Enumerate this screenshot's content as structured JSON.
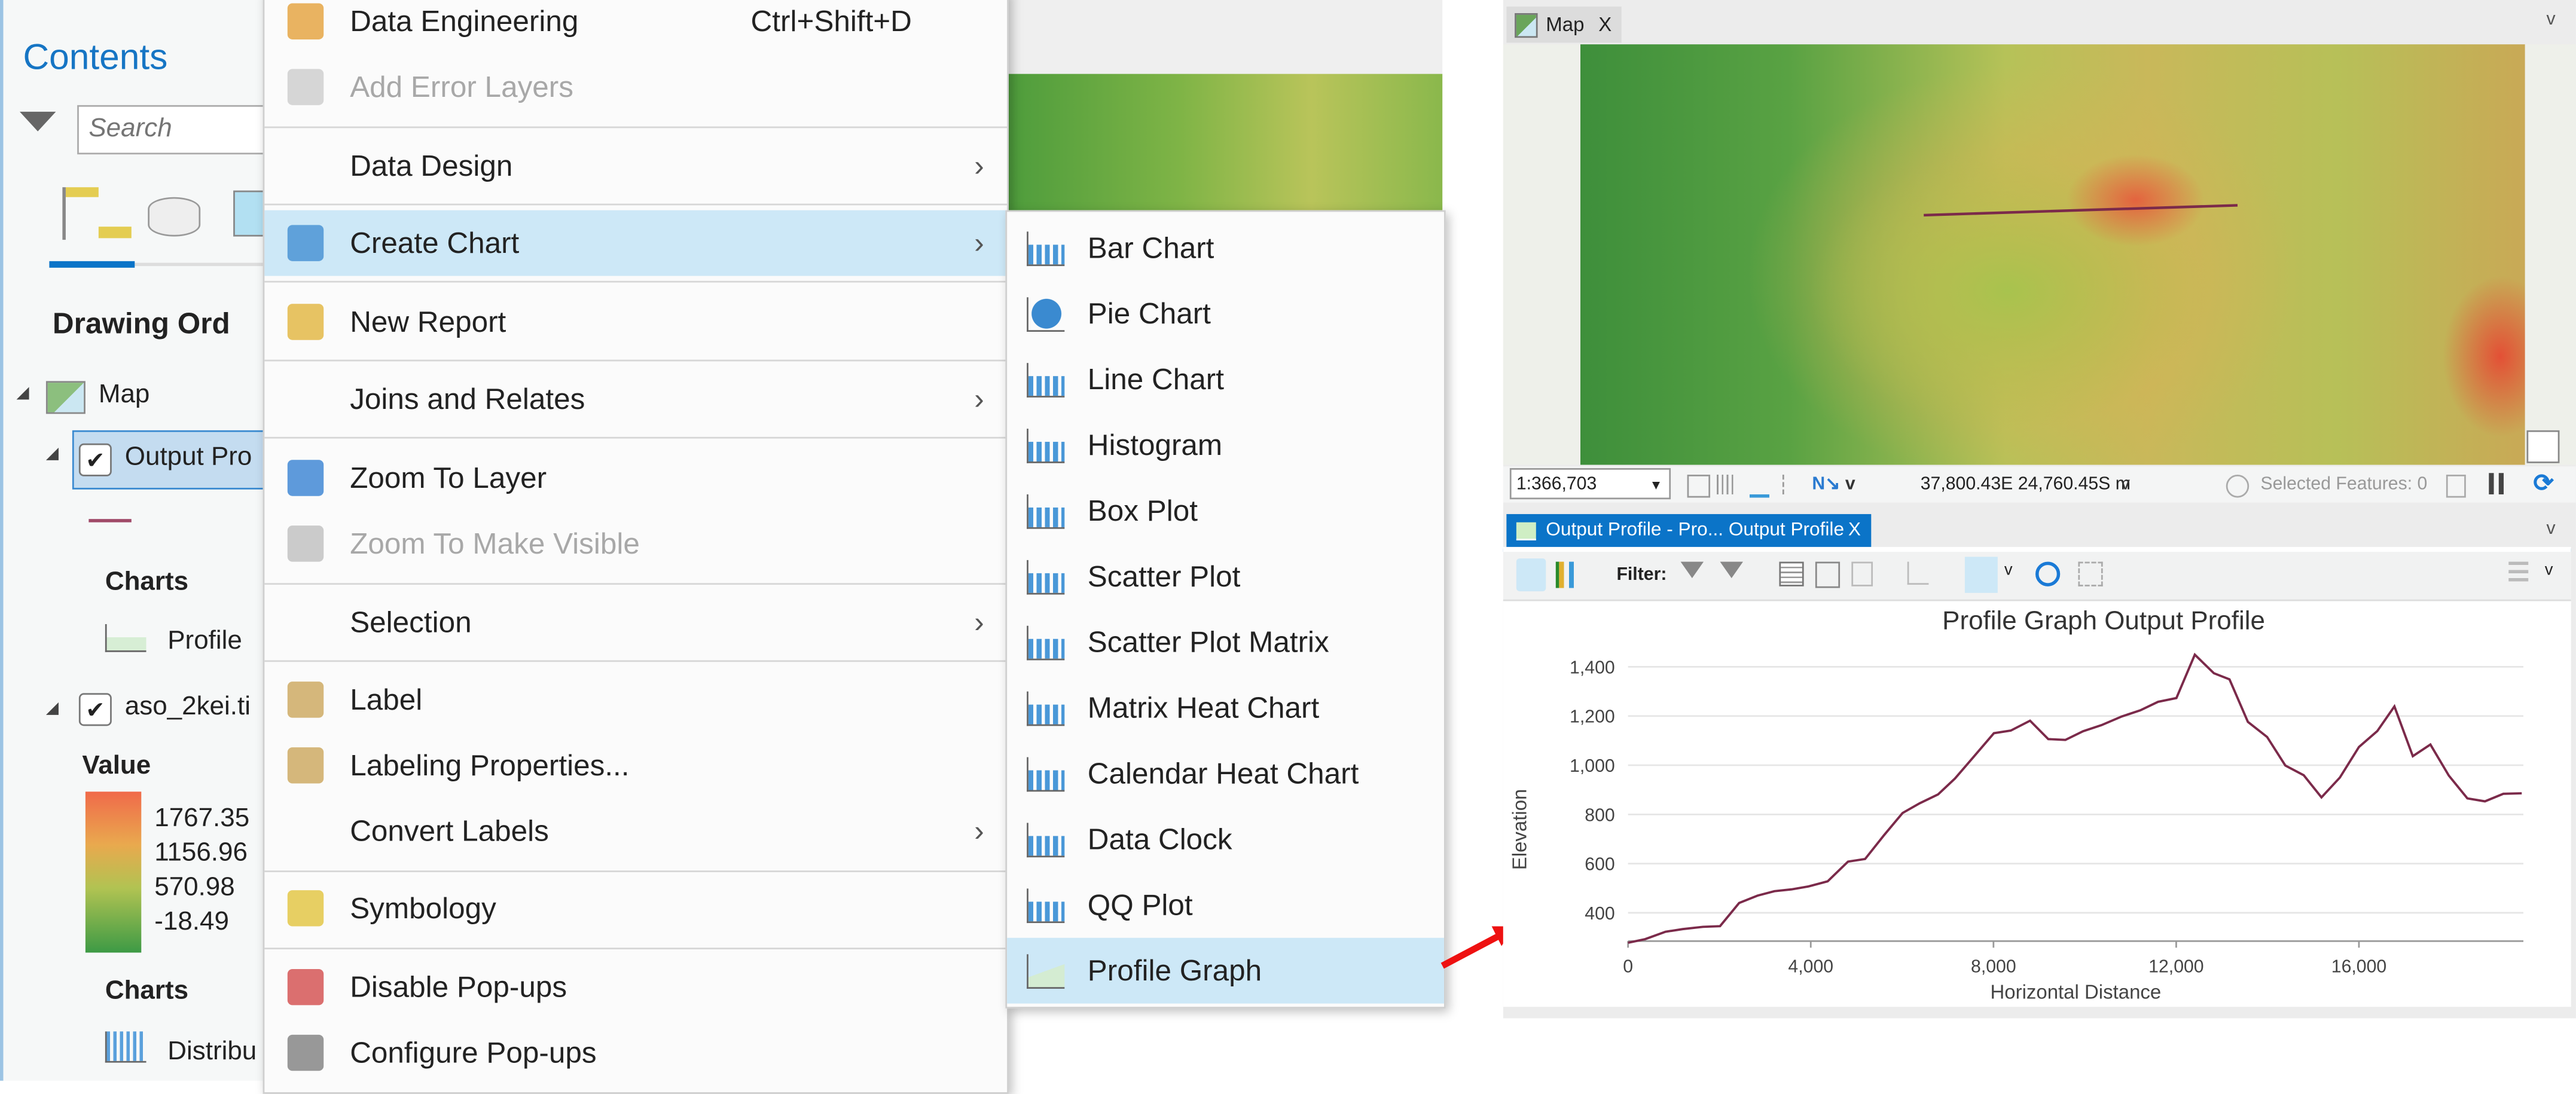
{
  "contents": {
    "title": "Contents",
    "search_placeholder": "Search",
    "drawing_order": "Drawing Ord",
    "map_label": "Map",
    "layer1": "Output Pro",
    "charts_heading": "Charts",
    "profile_chart": "Profile",
    "layer2": "aso_2kei.ti",
    "legend_title": "Value",
    "legend_values": [
      "1767.35",
      "1156.96",
      "570.98",
      "-18.49"
    ],
    "charts_heading2": "Charts",
    "distribution_chart": "Distribu"
  },
  "menu": {
    "items": [
      {
        "label": "Data Engineering",
        "shortcut": "Ctrl+Shift+D",
        "icon": "data-engineering-icon"
      },
      {
        "label": "Add Error Layers",
        "disabled": true,
        "icon": "error-layers-icon"
      },
      {
        "label": "Data Design",
        "submenu": true
      },
      {
        "label": "Create Chart",
        "submenu": true,
        "highlighted": true,
        "icon": "bar-chart-icon"
      },
      {
        "label": "New Report",
        "icon": "report-icon"
      },
      {
        "label": "Joins and Relates",
        "submenu": true
      },
      {
        "label": "Zoom To Layer",
        "icon": "zoom-layer-icon"
      },
      {
        "label": "Zoom To Make Visible",
        "disabled": true,
        "icon": "zoom-visible-icon"
      },
      {
        "label": "Selection",
        "submenu": true
      },
      {
        "label": "Label",
        "icon": "label-icon"
      },
      {
        "label": "Labeling Properties...",
        "icon": "labeling-properties-icon"
      },
      {
        "label": "Convert Labels",
        "submenu": true
      },
      {
        "label": "Symbology",
        "icon": "symbology-icon"
      },
      {
        "label": "Disable Pop-ups",
        "icon": "disable-popups-icon"
      },
      {
        "label": "Configure Pop-ups",
        "icon": "configure-popups-icon"
      }
    ],
    "submenu_arrow": "›"
  },
  "submenu": {
    "items": [
      {
        "label": "Bar Chart"
      },
      {
        "label": "Pie Chart"
      },
      {
        "label": "Line Chart"
      },
      {
        "label": "Histogram"
      },
      {
        "label": "Box Plot"
      },
      {
        "label": "Scatter Plot"
      },
      {
        "label": "Scatter Plot Matrix"
      },
      {
        "label": "Matrix Heat Chart"
      },
      {
        "label": "Calendar Heat Chart"
      },
      {
        "label": "Data Clock"
      },
      {
        "label": "QQ Plot"
      },
      {
        "label": "Profile Graph",
        "highlighted": true
      }
    ]
  },
  "mapview": {
    "tab_label": "Map",
    "close": "X",
    "scale": "1:366,703",
    "coordinates": "37,800.43E 24,760.45S m",
    "selected_features": "Selected Features: 0",
    "profile_line_color": "#7b2a4a"
  },
  "chartview": {
    "tab_label": "Output Profile - Pro... Output Profile",
    "close": "X",
    "filter_label": "Filter:"
  },
  "colors": {
    "accent": "#0b74c8",
    "highlight": "#cde8f7",
    "line": "#7b2a4a",
    "arrow": "#ee1111"
  },
  "chart_data": {
    "type": "line",
    "title": "Profile Graph Output Profile",
    "xlabel": "Horizontal Distance",
    "ylabel": "Elevation",
    "xlim": [
      0,
      19600
    ],
    "ylim": [
      285,
      1460
    ],
    "xticks": [
      0,
      4000,
      8000,
      12000,
      16000
    ],
    "xtick_labels": [
      "0",
      "4,000",
      "8,000",
      "12,000",
      "16,000"
    ],
    "yticks": [
      400,
      600,
      800,
      1000,
      1200,
      1400
    ],
    "ytick_labels": [
      "400",
      "600",
      "800",
      "1,000",
      "1,200",
      "1,400"
    ],
    "grid": true,
    "series": [
      {
        "x": [
          0,
          373,
          820,
          1193,
          1640,
          2013,
          2431,
          2833,
          3206,
          3579,
          3952,
          4370,
          4817,
          5190,
          5593,
          6010,
          6383,
          6786,
          7158,
          7606,
          8008,
          8381,
          8799,
          9201,
          9574,
          9962,
          10365,
          10812,
          11215,
          11603,
          12006,
          12407,
          12824,
          13167,
          13570,
          13988,
          14390,
          14793,
          15181,
          15584,
          16000,
          16403,
          16776,
          17178,
          17566,
          17969,
          18372,
          18760,
          19162,
          19565
        ],
        "y": [
          278,
          293,
          323,
          334,
          343,
          346,
          440,
          470,
          488,
          495,
          507,
          528,
          608,
          619,
          713,
          806,
          845,
          881,
          946,
          1043,
          1130,
          1141,
          1181,
          1106,
          1103,
          1138,
          1163,
          1198,
          1223,
          1258,
          1273,
          1449,
          1374,
          1349,
          1176,
          1115,
          999,
          959,
          869,
          950,
          1074,
          1139,
          1239,
          1037,
          1084,
          958,
          865,
          853,
          884,
          886
        ]
      }
    ]
  }
}
